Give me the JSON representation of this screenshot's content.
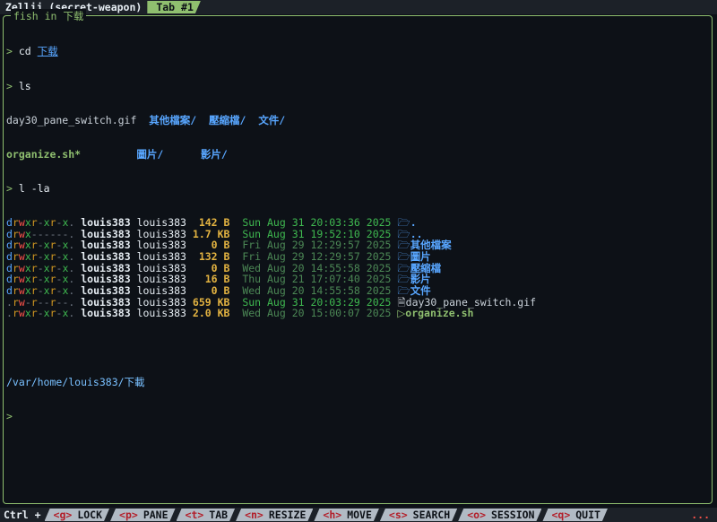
{
  "topbar": {
    "app_title": "Zellij (secret-weapon)",
    "active_tab": "Tab #1"
  },
  "pane": {
    "title": "fish in 下载"
  },
  "terminal": {
    "lines": [
      {
        "t": "cmd",
        "prompt": ">",
        "cmd": "cd",
        "arg": "下载"
      },
      {
        "t": "cmd",
        "prompt": ">",
        "cmd": "ls",
        "arg": ""
      },
      {
        "t": "ls",
        "items": [
          "day30_pane_switch.gif  ",
          "其他檔案/  ",
          "壓縮檔/  ",
          "文件/"
        ]
      },
      {
        "t": "ls2",
        "items": [
          "organize.sh*         ",
          "圖片/      ",
          "影片/"
        ]
      },
      {
        "t": "cmd",
        "prompt": ">",
        "cmd": "l -la",
        "arg": ""
      }
    ],
    "listing": [
      {
        "perm": "drwxr-xr-x.",
        "user": "louis383",
        "group": "louis383",
        "size": "142 B",
        "date": "Sun Aug 31 20:03:36 2025",
        "name": ".",
        "kind": "dir"
      },
      {
        "perm": "drwx------.",
        "user": "louis383",
        "group": "louis383",
        "size": "1.7 KB",
        "date": "Sun Aug 31 19:52:10 2025",
        "name": "..",
        "kind": "dir"
      },
      {
        "perm": "drwxr-xr-x.",
        "user": "louis383",
        "group": "louis383",
        "size": "0 B",
        "date": "Fri Aug 29 12:29:57 2025",
        "name": "其他檔案",
        "kind": "dir"
      },
      {
        "perm": "drwxr-xr-x.",
        "user": "louis383",
        "group": "louis383",
        "size": "132 B",
        "date": "Fri Aug 29 12:29:57 2025",
        "name": "圖片",
        "kind": "dir"
      },
      {
        "perm": "drwxr-xr-x.",
        "user": "louis383",
        "group": "louis383",
        "size": "0 B",
        "date": "Wed Aug 20 14:55:58 2025",
        "name": "壓縮檔",
        "kind": "dir"
      },
      {
        "perm": "drwxr-xr-x.",
        "user": "louis383",
        "group": "louis383",
        "size": "16 B",
        "date": "Thu Aug 21 17:07:40 2025",
        "name": "影片",
        "kind": "dir"
      },
      {
        "perm": "drwxr-xr-x.",
        "user": "louis383",
        "group": "louis383",
        "size": "0 B",
        "date": "Wed Aug 20 14:55:58 2025",
        "name": "文件",
        "kind": "dir"
      },
      {
        "perm": ".rw-r--r--.",
        "user": "louis383",
        "group": "louis383",
        "size": "659 KB",
        "date": "Sun Aug 31 20:03:29 2025",
        "name": "day30_pane_switch.gif",
        "kind": "file"
      },
      {
        "perm": ".rwxr-xr-x.",
        "user": "louis383",
        "group": "louis383",
        "size": "2.0 KB",
        "date": "Wed Aug 20 15:00:07 2025",
        "name": "organize.sh",
        "kind": "exe"
      }
    ],
    "cwd": "/var/home/louis383/下載",
    "final_prompt": ">"
  },
  "statusbar": {
    "ctrl_label": "Ctrl +",
    "keys": [
      {
        "key": "<g>",
        "label": "LOCK"
      },
      {
        "key": "<p>",
        "label": "PANE"
      },
      {
        "key": "<t>",
        "label": "TAB"
      },
      {
        "key": "<n>",
        "label": "RESIZE"
      },
      {
        "key": "<h>",
        "label": "MOVE"
      },
      {
        "key": "<s>",
        "label": "SEARCH"
      },
      {
        "key": "<o>",
        "label": "SESSION"
      },
      {
        "key": "<q>",
        "label": "QUIT"
      }
    ],
    "overflow": "..."
  },
  "colors": {
    "accent": "#8fbf6f",
    "dir": "#58a6ff",
    "size": "#e3b341",
    "date": "#3fb950"
  },
  "icons": {
    "dir": "folder-icon",
    "file": "file-icon",
    "exe": "script-icon"
  }
}
